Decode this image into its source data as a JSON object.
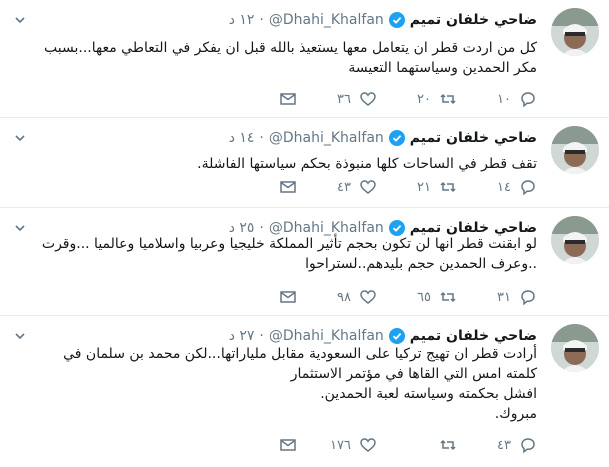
{
  "tweets": [
    {
      "name": "ضاحي خلفان تميم",
      "handle": "@Dhahi_Khalfan",
      "time": "١٢ د",
      "lines": [
        "كل من اردت قطر ان يتعامل معها يستعيذ بالله قبل ان يفكر في التعاطي معها...بسبب",
        "مكر الحمدين  وسياستهما التعيسة"
      ],
      "replies": "١٠",
      "retweets": "٢٠",
      "likes": "٣٦"
    },
    {
      "name": "ضاحي خلفان تميم",
      "handle": "@Dhahi_Khalfan",
      "time": "١٤ د",
      "lines": [
        "تقف قطر في الساحات كلها منبوذة بحكم سياستها الفاشلة."
      ],
      "replies": "١٤",
      "retweets": "٢١",
      "likes": "٤٣"
    },
    {
      "name": "ضاحي خلفان تميم",
      "handle": "@Dhahi_Khalfan",
      "time": "٢٥ د",
      "lines": [
        "لو ابقنت قطر انها لن تكون بحجم تأثير المملكة خليجيا وعربيا واسلاميا وعالميا ...وقرت",
        "..وعرف الحمدين حجم بليدهم..لستراحوا"
      ],
      "replies": "٣١",
      "retweets": "٦٥",
      "likes": "٩٨"
    },
    {
      "name": "ضاحي خلفان تميم",
      "handle": "@Dhahi_Khalfan",
      "time": "٢٧ د",
      "lines": [
        "أرادت قطر ان تهيج تركيا على السعودية مقابل ملياراتها...لكن محمد بن سلمان في",
        "كلمته امس التي القاها في مؤتمر الاستثمار",
        "افشل بحكمته وسياسته لعبة الحمدين.",
        "مبروك."
      ],
      "replies": "٤٣",
      "retweets": "",
      "likes": "١٧٦"
    }
  ],
  "colors": {
    "verified": "#1da1f2",
    "secondary": "#657786",
    "divider": "#e6ecf0"
  },
  "icons": {
    "verified": "verified-badge-icon",
    "menu": "chevron-down-icon",
    "reply": "reply-icon",
    "retweet": "retweet-icon",
    "like": "heart-icon",
    "dm": "envelope-icon"
  }
}
